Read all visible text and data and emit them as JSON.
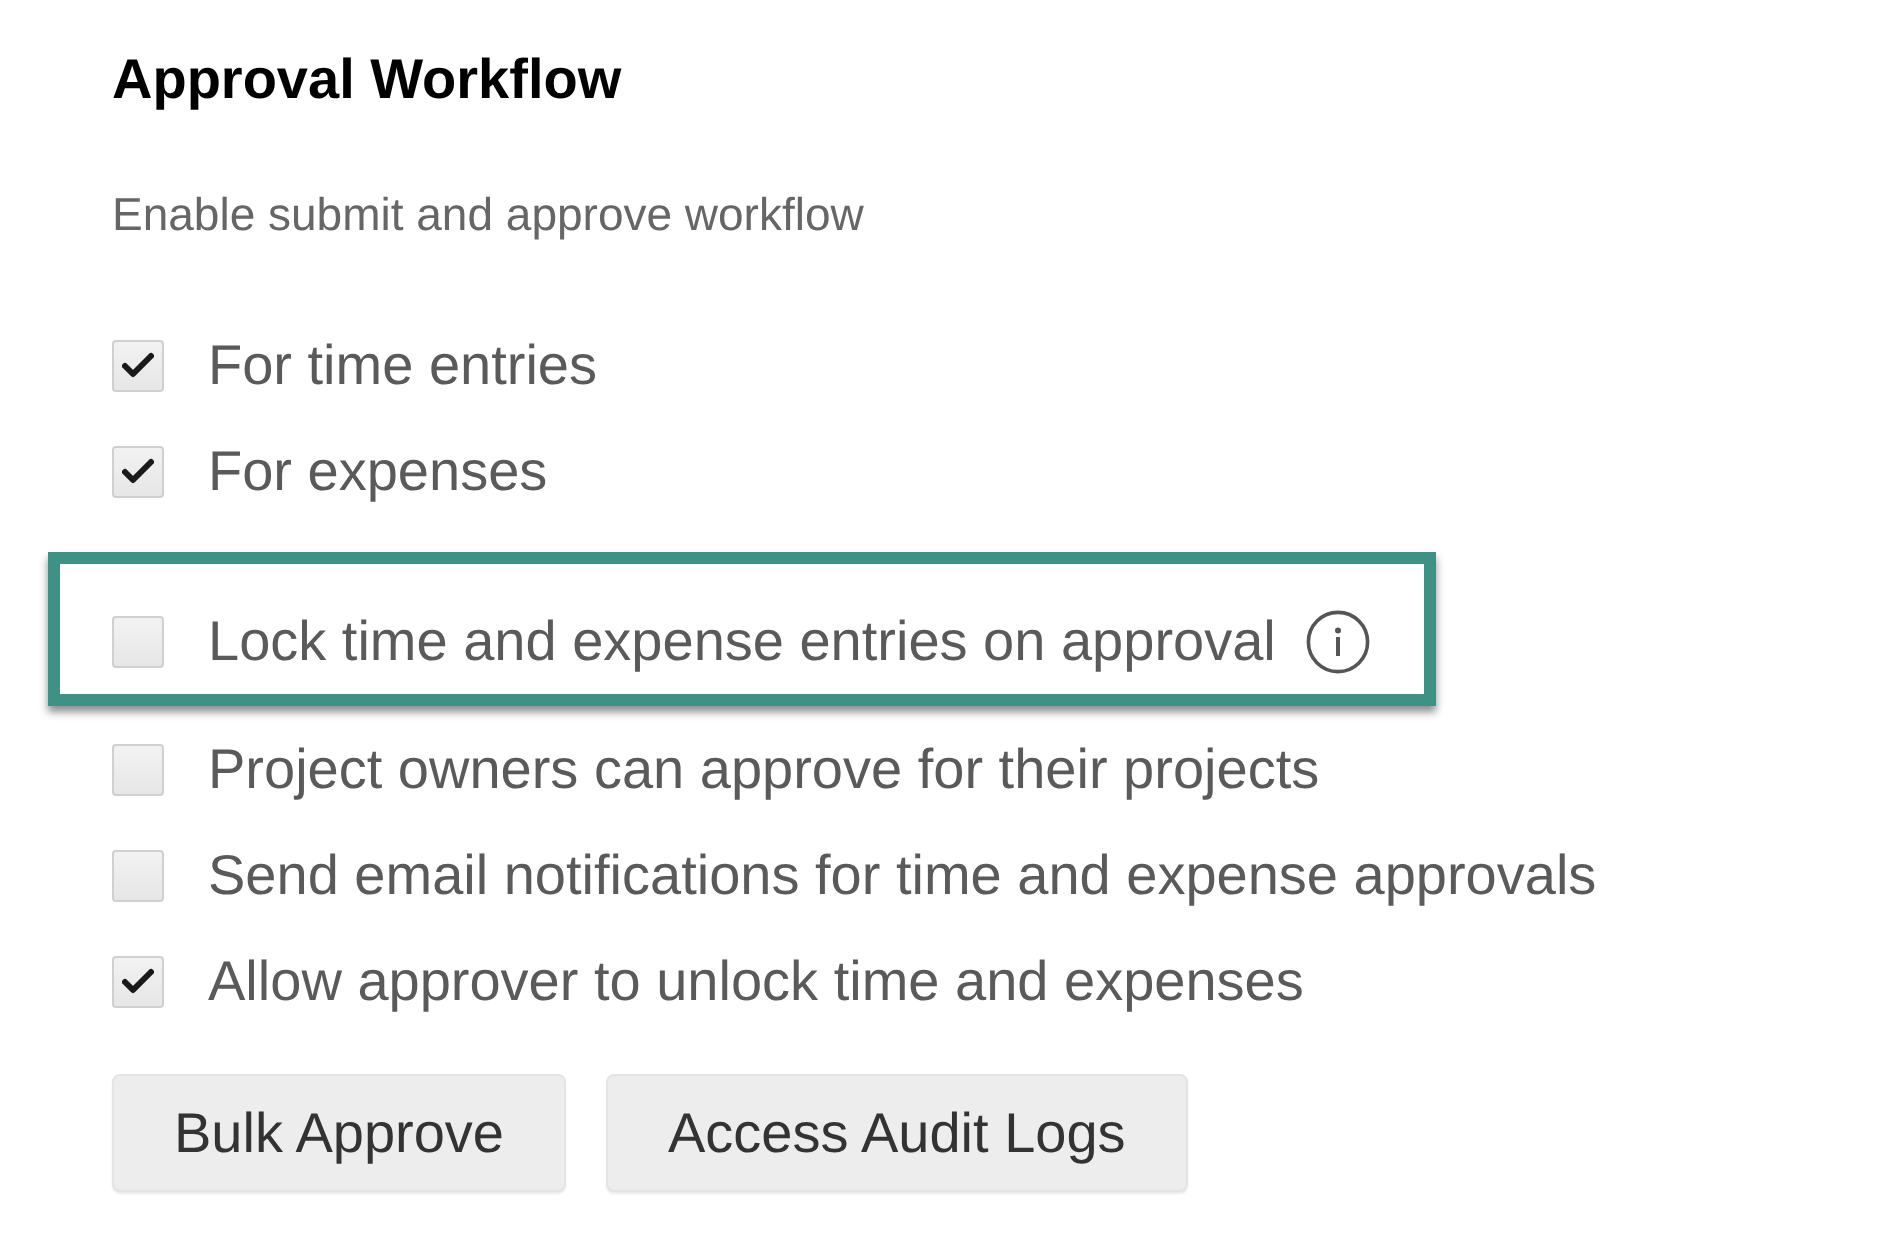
{
  "section": {
    "title": "Approval Workflow",
    "subtitle": "Enable submit and approve workflow"
  },
  "options": [
    {
      "label": "For time entries",
      "checked": true,
      "highlighted": false,
      "info": false
    },
    {
      "label": "For expenses",
      "checked": true,
      "highlighted": false,
      "info": false
    },
    {
      "label": "Lock time and expense entries on approval",
      "checked": false,
      "highlighted": true,
      "info": true
    },
    {
      "label": "Project owners can approve for their projects",
      "checked": false,
      "highlighted": false,
      "info": false
    },
    {
      "label": "Send email notifications for time and expense approvals",
      "checked": false,
      "highlighted": false,
      "info": false
    },
    {
      "label": "Allow approver to unlock time and expenses",
      "checked": true,
      "highlighted": false,
      "info": false
    }
  ],
  "buttons": [
    {
      "label": "Bulk Approve"
    },
    {
      "label": "Access Audit Logs"
    }
  ]
}
